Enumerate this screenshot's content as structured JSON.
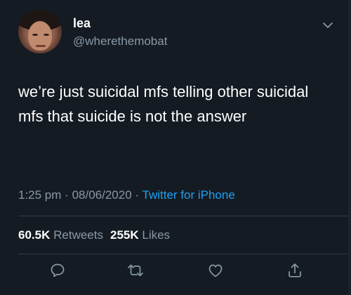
{
  "tweet": {
    "display_name": "lea",
    "handle": "@wherethemobat",
    "text": "we’re just suicidal mfs telling other suicidal mfs that suicide is not the answer",
    "time": "1:25 pm",
    "date": "08/06/2020",
    "separator": "·",
    "source": "Twitter for iPhone",
    "retweets_count": "60.5K",
    "retweets_label": "Retweets",
    "likes_count": "255K",
    "likes_label": "Likes"
  },
  "icons": {
    "menu": "chevron-down-icon",
    "reply": "reply-icon",
    "retweet": "retweet-icon",
    "like": "heart-icon",
    "share": "share-icon"
  },
  "colors": {
    "background": "#151b23",
    "text": "#ffffff",
    "secondary_text": "#8899a6",
    "accent": "#1da1f2",
    "divider": "#2f3b47"
  }
}
